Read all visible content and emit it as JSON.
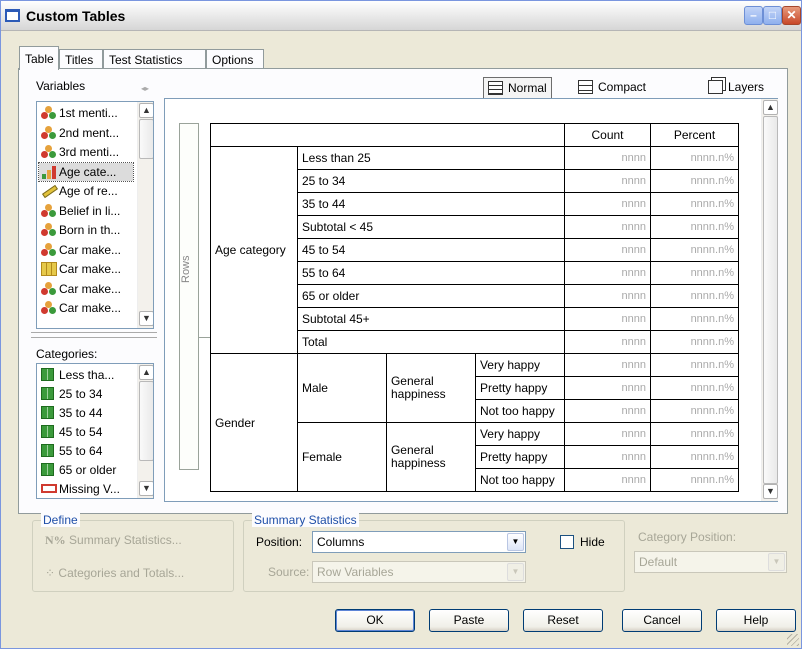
{
  "window": {
    "title": "Custom Tables"
  },
  "tabs": [
    {
      "label": "Table"
    },
    {
      "label": "Titles"
    },
    {
      "label": "Test Statistics"
    },
    {
      "label": "Options"
    }
  ],
  "variables": {
    "label": "Variables",
    "items": [
      {
        "label": "1st menti...",
        "icon": "nominal-icon"
      },
      {
        "label": "2nd ment...",
        "icon": "nominal-icon"
      },
      {
        "label": "3rd menti...",
        "icon": "nominal-icon"
      },
      {
        "label": "Age cate...",
        "icon": "ordinal-icon"
      },
      {
        "label": "Age of re...",
        "icon": "scale-icon"
      },
      {
        "label": "Belief in li...",
        "icon": "nominal-icon"
      },
      {
        "label": "Born in th...",
        "icon": "nominal-icon"
      },
      {
        "label": "Car make...",
        "icon": "nominal-icon"
      },
      {
        "label": "Car make...",
        "icon": "multiple-response-icon"
      },
      {
        "label": "Car make...",
        "icon": "nominal-icon"
      },
      {
        "label": "Car make...",
        "icon": "nominal-icon"
      }
    ]
  },
  "categories": {
    "label": "Categories:",
    "items": [
      "Less tha...",
      "25 to 34",
      "35 to 44",
      "45 to 54",
      "55 to 64",
      "65 or older",
      "Missing V..."
    ]
  },
  "view": {
    "normal": "Normal",
    "compact": "Compact",
    "layers": "Layers"
  },
  "canvas": {
    "rows_label": "Rows",
    "header": {
      "count": "Count",
      "percent": "Percent"
    },
    "age": {
      "var": "Age category",
      "rows": [
        "Less than 25",
        "25 to 34",
        "35 to 44",
        "Subtotal < 45",
        "45 to 54",
        "55 to 64",
        "65 or older",
        "Subtotal  45+",
        "Total"
      ]
    },
    "gender": {
      "var": "Gender",
      "male": "Male",
      "female": "Female",
      "happiness": "General happiness",
      "levels": [
        "Very happy",
        "Pretty happy",
        "Not too happy"
      ]
    },
    "placeholder_count": "nnnn",
    "placeholder_percent": "nnnn.n%"
  },
  "define": {
    "title": "Define",
    "summary_stats": "Summary Statistics...",
    "categories_totals": "Categories and Totals..."
  },
  "summary": {
    "title": "Summary Statistics",
    "position_label": "Position:",
    "position_value": "Columns",
    "hide_label": "Hide",
    "source_label": "Source:",
    "source_value": "Row Variables"
  },
  "category_position": {
    "label": "Category Position:",
    "value": "Default"
  },
  "buttons": {
    "ok": "OK",
    "paste": "Paste",
    "reset": "Reset",
    "cancel": "Cancel",
    "help": "Help"
  }
}
